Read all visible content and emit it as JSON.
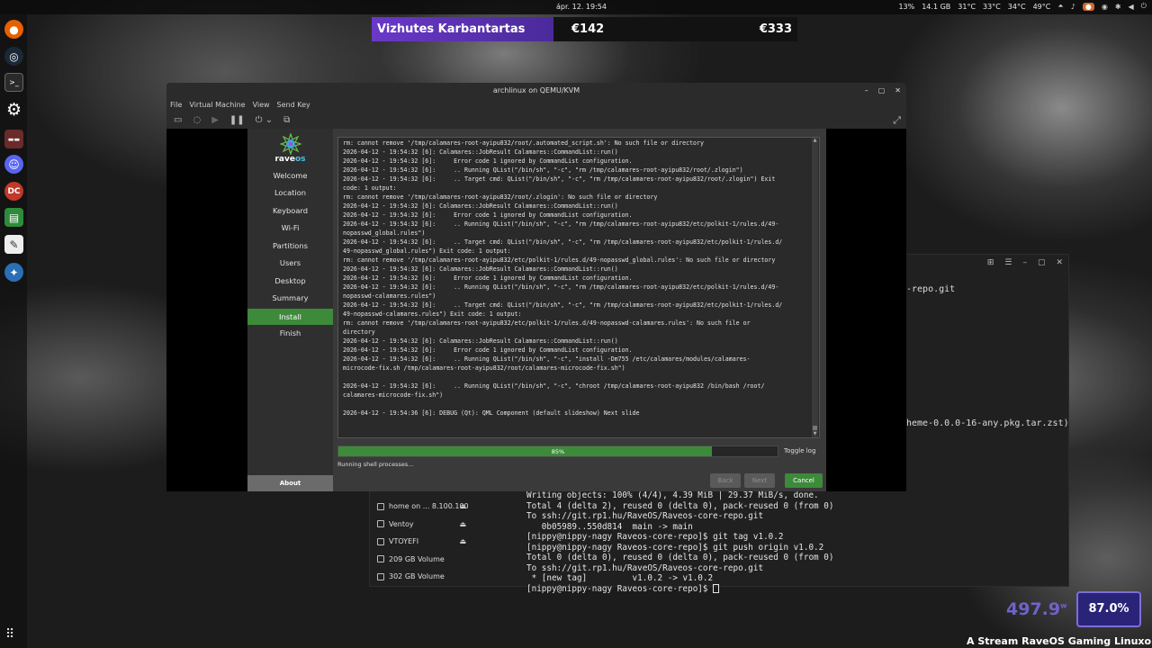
{
  "topbar": {
    "clock": "ápr. 12.  19:54",
    "tray": [
      "13%",
      "14.1 GB",
      "31°C",
      "33°C",
      "34°C",
      "49°C"
    ]
  },
  "overlay": {
    "name": "Vizhutes Karbantartas",
    "price1": "€142",
    "price2": "€333"
  },
  "dock": [
    "firefox-icon",
    "steam-icon",
    "terminal-icon",
    "settings-icon",
    "game-icon",
    "discord-icon",
    "app-icon",
    "calc-icon",
    "text-editor-icon",
    "installer-icon"
  ],
  "vm": {
    "title": "archlinux on QEMU/KVM",
    "menu": [
      "File",
      "Virtual Machine",
      "View",
      "Send Key"
    ]
  },
  "installer": {
    "brand": "raveos",
    "steps": [
      "Welcome",
      "Location",
      "Keyboard",
      "Wi-Fi",
      "Partitions",
      "Users",
      "Desktop",
      "Summary",
      "Install",
      "Finish"
    ],
    "active_step": "Install",
    "about": "About",
    "log": [
      "rm: cannot remove '/tmp/calamares-root-ayipu832/root/.automated_script.sh': No such file or directory",
      "2026-04-12 - 19:54:32 [6]: Calamares::JobResult Calamares::CommandList::run()",
      "2026-04-12 - 19:54:32 [6]:     Error code 1 ignored by CommandList configuration.",
      "2026-04-12 - 19:54:32 [6]:     .. Running QList(\"/bin/sh\", \"-c\", \"rm /tmp/calamares-root-ayipu832/root/.zlogin\")",
      "2026-04-12 - 19:54:32 [6]:     .. Target cmd: QList(\"/bin/sh\", \"-c\", \"rm /tmp/calamares-root-ayipu832/root/.zlogin\") Exit",
      "code: 1 output:",
      "rm: cannot remove '/tmp/calamares-root-ayipu832/root/.zlogin': No such file or directory",
      "2026-04-12 - 19:54:32 [6]: Calamares::JobResult Calamares::CommandList::run()",
      "2026-04-12 - 19:54:32 [6]:     Error code 1 ignored by CommandList configuration.",
      "2026-04-12 - 19:54:32 [6]:     .. Running QList(\"/bin/sh\", \"-c\", \"rm /tmp/calamares-root-ayipu832/etc/polkit-1/rules.d/49-",
      "nopasswd_global.rules\")",
      "2026-04-12 - 19:54:32 [6]:     .. Target cmd: QList(\"/bin/sh\", \"-c\", \"rm /tmp/calamares-root-ayipu832/etc/polkit-1/rules.d/",
      "49-nopasswd_global.rules\") Exit code: 1 output:",
      "rm: cannot remove '/tmp/calamares-root-ayipu832/etc/polkit-1/rules.d/49-nopasswd_global.rules': No such file or directory",
      "2026-04-12 - 19:54:32 [6]: Calamares::JobResult Calamares::CommandList::run()",
      "2026-04-12 - 19:54:32 [6]:     Error code 1 ignored by CommandList configuration.",
      "2026-04-12 - 19:54:32 [6]:     .. Running QList(\"/bin/sh\", \"-c\", \"rm /tmp/calamares-root-ayipu832/etc/polkit-1/rules.d/49-",
      "nopasswd-calamares.rules\")",
      "2026-04-12 - 19:54:32 [6]:     .. Target cmd: QList(\"/bin/sh\", \"-c\", \"rm /tmp/calamares-root-ayipu832/etc/polkit-1/rules.d/",
      "49-nopasswd-calamares.rules\") Exit code: 1 output:",
      "rm: cannot remove '/tmp/calamares-root-ayipu832/etc/polkit-1/rules.d/49-nopasswd-calamares.rules': No such file or",
      "directory",
      "2026-04-12 - 19:54:32 [6]: Calamares::JobResult Calamares::CommandList::run()",
      "2026-04-12 - 19:54:32 [6]:     Error code 1 ignored by CommandList configuration.",
      "2026-04-12 - 19:54:32 [6]:     .. Running QList(\"/bin/sh\", \"-c\", \"install -Dm755 /etc/calamares/modules/calamares-",
      "microcode-fix.sh /tmp/calamares-root-ayipu832/root/calamares-microcode-fix.sh\")",
      "",
      "2026-04-12 - 19:54:32 [6]:     .. Running QList(\"/bin/sh\", \"-c\", \"chroot /tmp/calamares-root-ayipu832 /bin/bash /root/",
      "calamares-microcode-fix.sh\")",
      "",
      "2026-04-12 - 19:54:36 [6]: DEBUG (Qt): QML Component (default slideshow) Next slide"
    ],
    "progress": 0.85,
    "progress_label": "85%",
    "toggle_log": "Toggle log",
    "status": "Running shell processes...",
    "buttons": {
      "back": "Back",
      "next": "Next",
      "cancel": "Cancel"
    }
  },
  "terminal": {
    "fragment1": "-repo.git",
    "fragment2": "heme-0.0.0-16-any.pkg.tar.zst)",
    "lines": [
      "Writing objects: 100% (4/4), 4.39 MiB | 29.37 MiB/s, done.",
      "Total 4 (delta 2), reused 0 (delta 0), pack-reused 0 (from 0)",
      "To ssh://git.rp1.hu/RaveOS/Raveos-core-repo.git",
      "   0b05989..550d814  main -> main",
      "[nippy@nippy-nagy Raveos-core-repo]$ git tag v1.0.2",
      "[nippy@nippy-nagy Raveos-core-repo]$ git push origin v1.0.2",
      "Total 0 (delta 0), reused 0 (delta 0), pack-reused 0 (from 0)",
      "To ssh://git.rp1.hu/RaveOS/Raveos-core-repo.git",
      " * [new tag]         v1.0.2 -> v1.0.2"
    ],
    "prompt": "[nippy@nippy-nagy Raveos-core-repo]$ "
  },
  "files": [
    {
      "name": "home on ... 8.100.100",
      "eject": true
    },
    {
      "name": "Ventoy",
      "eject": true
    },
    {
      "name": "VTOYEFI",
      "eject": true
    },
    {
      "name": "209 GB Volume",
      "eject": false
    },
    {
      "name": "302 GB Volume",
      "eject": false
    }
  ],
  "widgets": {
    "watts": "497.9",
    "watts_unit": "w",
    "percent": "87.0%",
    "stream": "A Stream RaveOS Gaming Linuxon fut"
  }
}
